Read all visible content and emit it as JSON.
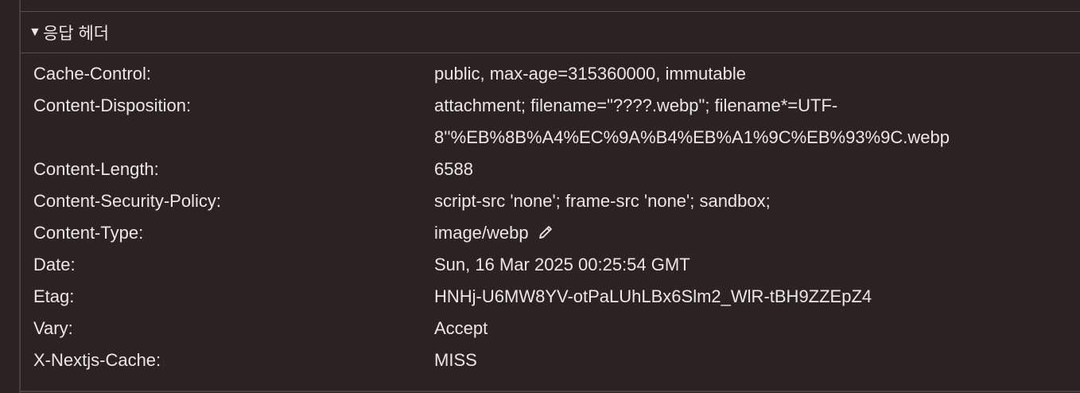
{
  "section": {
    "toggle_glyph": "▼",
    "title": "응답 헤더"
  },
  "headers": [
    {
      "name": "Cache-Control:",
      "value_lines": [
        "public, max-age=315360000, immutable"
      ]
    },
    {
      "name": "Content-Disposition:",
      "value_lines": [
        "attachment; filename=\"????.webp\"; filename*=UTF-",
        "8''%EB%8B%A4%EC%9A%B4%EB%A1%9C%EB%93%9C.webp"
      ]
    },
    {
      "name": "Content-Length:",
      "value_lines": [
        "6588"
      ]
    },
    {
      "name": "Content-Security-Policy:",
      "value_lines": [
        "script-src 'none'; frame-src 'none'; sandbox;"
      ]
    },
    {
      "name": "Content-Type:",
      "value_lines": [
        "image/webp"
      ],
      "editable_icon": "pencil-icon"
    },
    {
      "name": "Date:",
      "value_lines": [
        "Sun, 16 Mar 2025 00:25:54 GMT"
      ]
    },
    {
      "name": "Etag:",
      "value_lines": [
        "HNHj-U6MW8YV-otPaLUhLBx6Slm2_WlR-tBH9ZZEpZ4"
      ]
    },
    {
      "name": "Vary:",
      "value_lines": [
        "Accept"
      ]
    },
    {
      "name": "X-Nextjs-Cache:",
      "value_lines": [
        "MISS"
      ]
    }
  ],
  "colors": {
    "background": "#2b2224",
    "text": "#ece6e4",
    "divider": "#5a4d4e"
  }
}
